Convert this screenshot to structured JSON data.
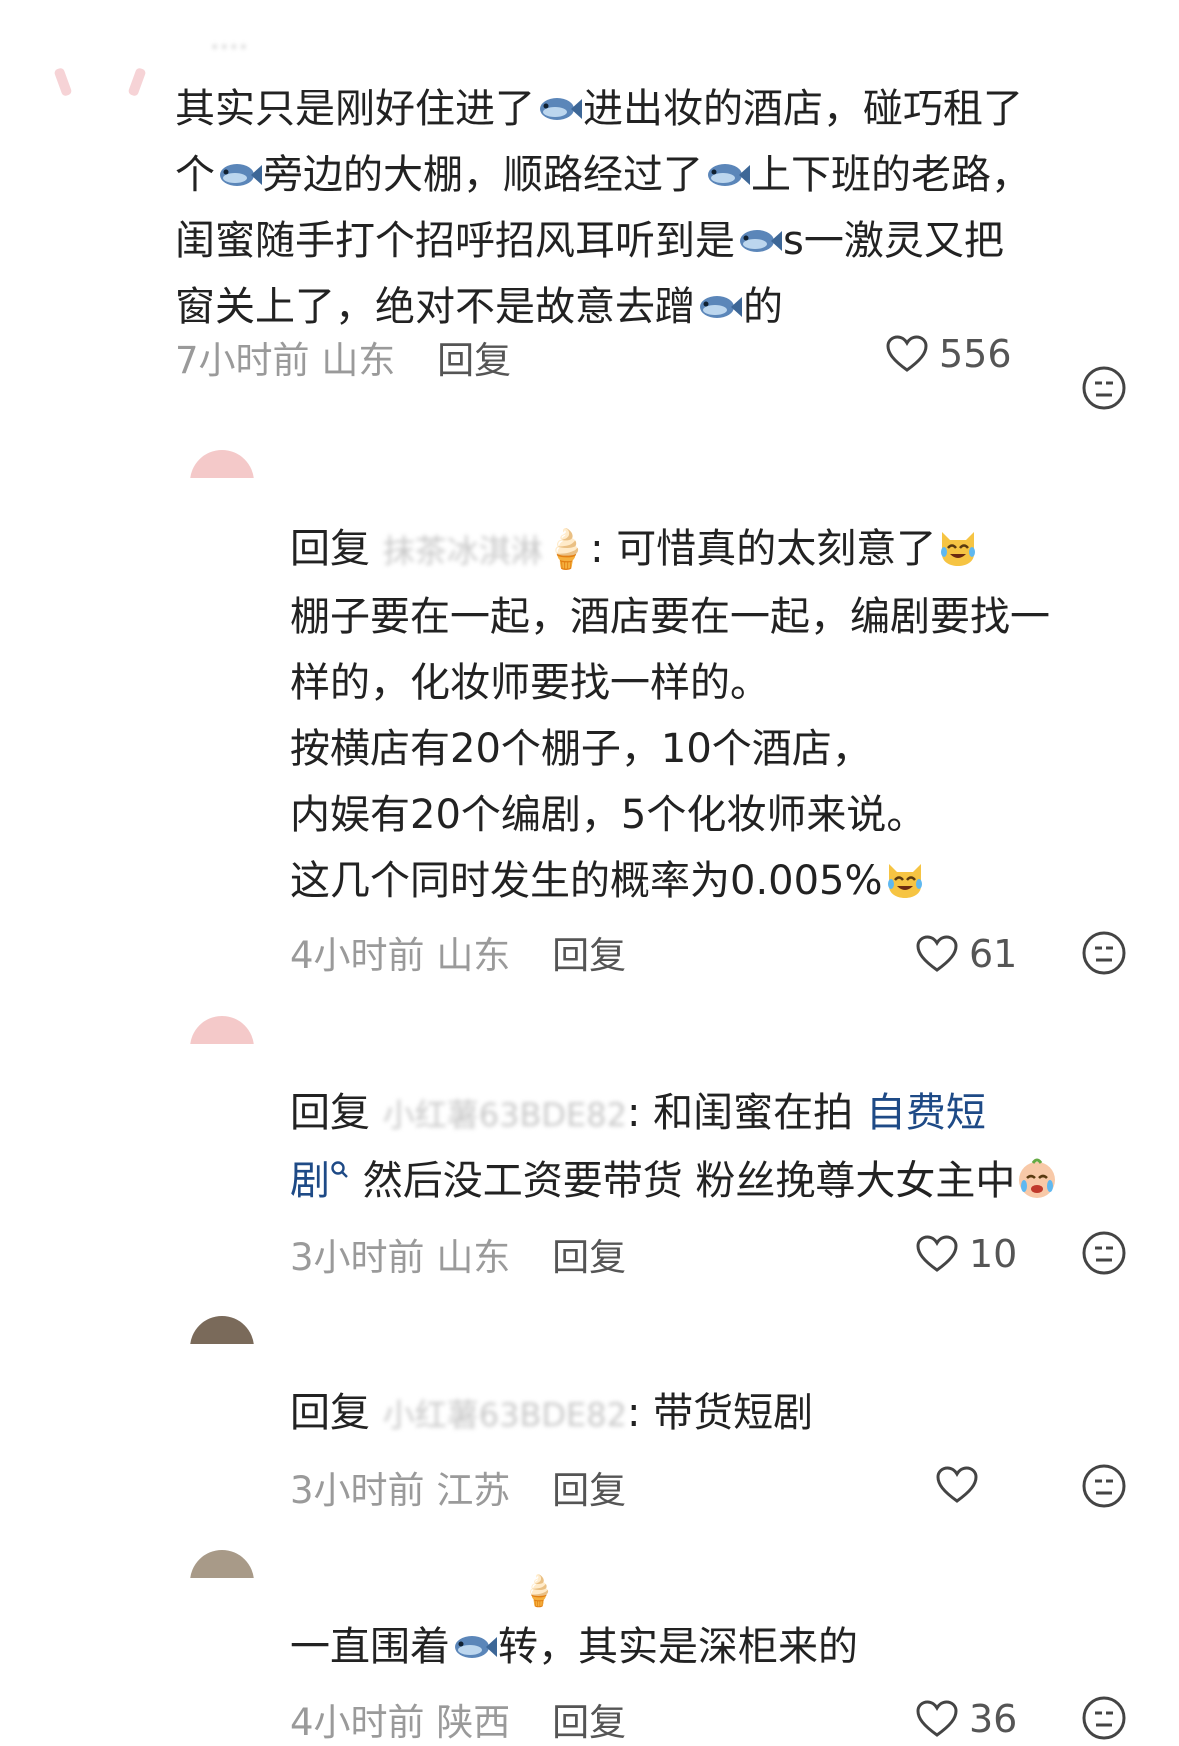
{
  "comments": [
    {
      "text_lines": [
        [
          "其实只是刚好住进了",
          "fish",
          "进出妆的酒店，碰巧租了"
        ],
        [
          "个",
          "fish",
          "旁边的大棚，顺路经过了",
          "fish",
          "上下班的老路，"
        ],
        [
          "闺蜜随手打个招呼招风耳听到是",
          "fish",
          "s一激灵又把"
        ],
        [
          "窗关上了，绝对不是故意去蹭",
          "fish",
          "的"
        ]
      ],
      "time": "7小时前",
      "location": "山东",
      "reply_label": "回复",
      "likes": "556"
    },
    {
      "reply_prefix": "回复",
      "reply_to": "抹茶冰淇淋",
      "line1_rest": ": 可惜真的太刻意了",
      "lines": [
        "棚子要在一起，酒店要在一起，编剧要找一",
        "样的，化妆师要找一样的。",
        "按横店有20个棚子，10个酒店，",
        "内娱有20个编剧，5个化妆师来说。",
        "这几个同时发生的概率为0.005%"
      ],
      "time": "4小时前",
      "location": "山东",
      "reply_label": "回复",
      "likes": "61"
    },
    {
      "reply_prefix": "回复",
      "reply_to": "小红薯63BDE82",
      "line1_rest": ": 和闺蜜在拍",
      "link_a": "自费短",
      "link_b": "剧",
      "line2_rest": " 然后没工资要带货 粉丝挽尊大女主中",
      "time": "3小时前",
      "location": "山东",
      "reply_label": "回复",
      "likes": "10"
    },
    {
      "reply_prefix": "回复",
      "reply_to": "小红薯63BDE82",
      "line1_rest": ": 带货短剧",
      "time": "3小时前",
      "location": "江苏",
      "reply_label": "回复",
      "likes": ""
    },
    {
      "text_a": "一直围着",
      "text_b": "转，其实是深柜来的",
      "time": "4小时前",
      "location": "陕西",
      "reply_label": "回复",
      "likes": "36"
    }
  ],
  "icons": {
    "like": "heart-outline-icon",
    "emoji_reply": "emoji-face-icon",
    "fish": "fish-emoji-icon"
  },
  "colors": {
    "text": "#222222",
    "meta": "#9a9a9a",
    "link": "#1e4a86"
  }
}
